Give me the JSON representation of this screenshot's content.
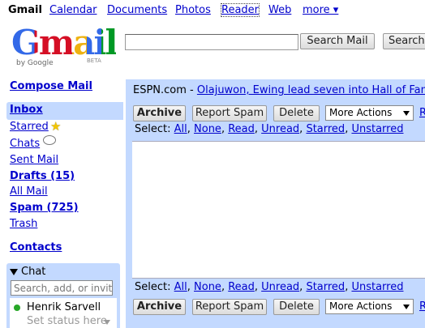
{
  "topbar": {
    "app": "Gmail",
    "links": [
      "Calendar",
      "Documents",
      "Photos",
      "Reader",
      "Web"
    ],
    "more": "more ▾"
  },
  "logo": {
    "text": "Gmail",
    "by": "by Google",
    "badge": "BETA"
  },
  "search": {
    "value": "",
    "search_mail": "Search Mail",
    "search_web": "Search"
  },
  "sidebar": {
    "compose": "Compose Mail",
    "items": [
      {
        "label": "Inbox",
        "bold": true
      },
      {
        "label": "Starred",
        "icon": "star-icon"
      },
      {
        "label": "Chats",
        "icon": "chat-bubble-icon"
      },
      {
        "label": "Sent Mail"
      },
      {
        "label": "Drafts (15)",
        "bold": true
      },
      {
        "label": "All Mail"
      },
      {
        "label": "Spam (725)",
        "bold": true
      },
      {
        "label": "Trash"
      }
    ],
    "contacts": "Contacts"
  },
  "chat": {
    "title": "Chat",
    "search_placeholder": "Search, add, or invite",
    "user": "Henrik Sarvell",
    "status": "Set status here",
    "status_color": "#28a828"
  },
  "clip": {
    "source": "ESPN.com - ",
    "headline": "Olajuwon, Ewing lead seven into Hall of Fame"
  },
  "toolbar": {
    "archive": "Archive",
    "report_spam": "Report Spam",
    "delete": "Delete",
    "more_actions": "More Actions",
    "edge": "R"
  },
  "select": {
    "label": "Select:",
    "options": [
      "All",
      "None",
      "Read",
      "Unread",
      "Starred",
      "Unstarred"
    ]
  },
  "colors": {
    "accent": "#c3d9ff",
    "link": "#0000cc"
  }
}
